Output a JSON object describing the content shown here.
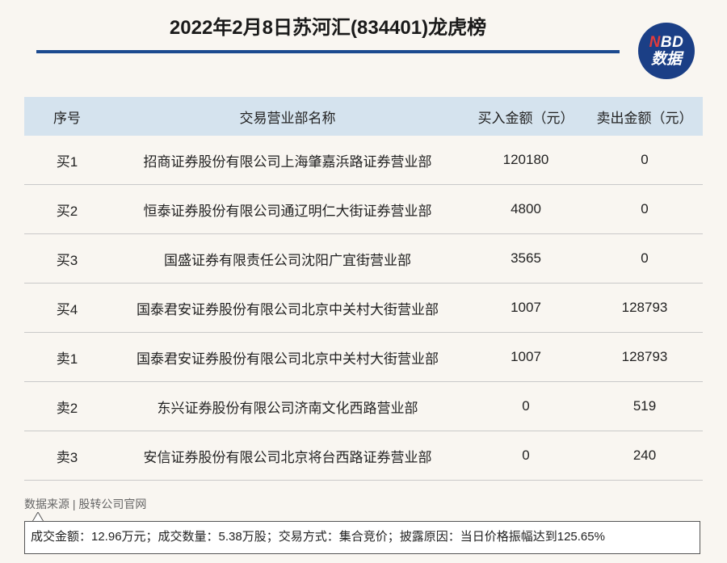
{
  "header": {
    "title": "2022年2月8日苏河汇(834401)龙虎榜",
    "logo_line1_n": "N",
    "logo_line1_rest": "BD",
    "logo_line2": "数据"
  },
  "table": {
    "columns": [
      "序号",
      "交易营业部名称",
      "买入金额（元）",
      "卖出金额（元）"
    ],
    "rows": [
      {
        "seq": "买1",
        "name": "招商证券股份有限公司上海肇嘉浜路证券营业部",
        "buy": "120180",
        "sell": "0"
      },
      {
        "seq": "买2",
        "name": "恒泰证券股份有限公司通辽明仁大街证券营业部",
        "buy": "4800",
        "sell": "0"
      },
      {
        "seq": "买3",
        "name": "国盛证券有限责任公司沈阳广宜街营业部",
        "buy": "3565",
        "sell": "0"
      },
      {
        "seq": "买4",
        "name": "国泰君安证券股份有限公司北京中关村大街营业部",
        "buy": "1007",
        "sell": "128793"
      },
      {
        "seq": "卖1",
        "name": "国泰君安证券股份有限公司北京中关村大街营业部",
        "buy": "1007",
        "sell": "128793"
      },
      {
        "seq": "卖2",
        "name": "东兴证券股份有限公司济南文化西路营业部",
        "buy": "0",
        "sell": "519"
      },
      {
        "seq": "卖3",
        "name": "安信证券股份有限公司北京将台西路证券营业部",
        "buy": "0",
        "sell": "240"
      }
    ]
  },
  "footer": {
    "source": "数据来源 | 股转公司官网",
    "summary": "成交金额：12.96万元；成交数量：5.38万股；交易方式：集合竞价；披露原因：当日价格振幅达到125.65%"
  },
  "colors": {
    "brand_blue": "#1c4a8f",
    "header_bg": "#d5e3ee",
    "logo_red": "#e23b3b"
  }
}
